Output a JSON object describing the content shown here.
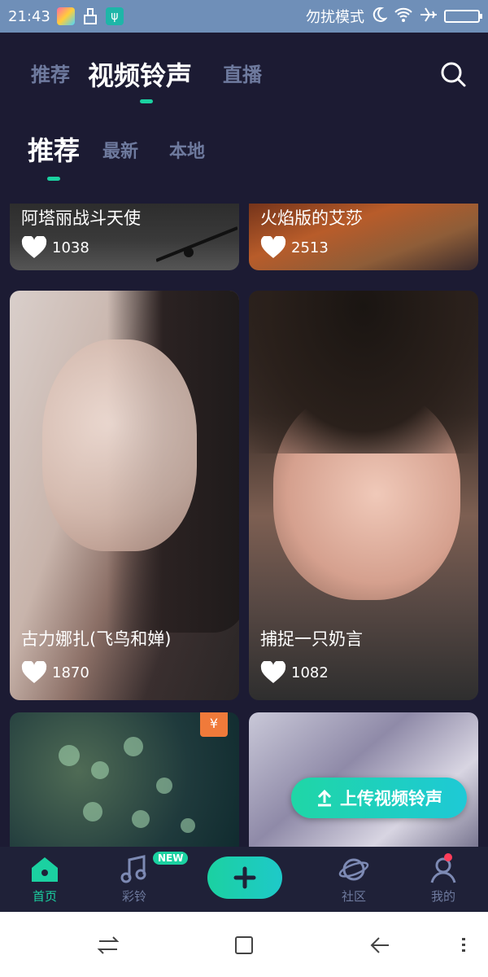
{
  "status_bar": {
    "time": "21:43",
    "dnd_label": "勿扰模式",
    "icons": [
      "photos-app-icon",
      "cleaner-icon",
      "usb-icon",
      "moon-icon",
      "wifi-icon",
      "airplane-icon",
      "battery-icon"
    ]
  },
  "top_tabs": {
    "items": [
      "推荐",
      "视频铃声",
      "直播"
    ],
    "active": "视频铃声"
  },
  "sub_tabs": {
    "items": [
      "推荐",
      "最新",
      "本地"
    ],
    "active": "推荐"
  },
  "cards": [
    {
      "title": "阿塔丽战斗天使",
      "likes": "1038"
    },
    {
      "title": "火焰版的艾莎",
      "likes": "2513"
    },
    {
      "title": "古力娜扎(飞鸟和婵)",
      "likes": "1870"
    },
    {
      "title": "捕捉一只奶言",
      "likes": "1082"
    },
    {
      "badge": "¥"
    },
    {}
  ],
  "upload_button": {
    "label": "上传视频铃声"
  },
  "bottom_nav": {
    "items": [
      {
        "label": "首页",
        "icon": "home-icon",
        "active": true
      },
      {
        "label": "彩铃",
        "icon": "music-note-icon",
        "badge": "NEW"
      },
      {
        "label": "",
        "icon": "plus-icon"
      },
      {
        "label": "社区",
        "icon": "planet-icon"
      },
      {
        "label": "我的",
        "icon": "profile-icon"
      }
    ]
  },
  "colors": {
    "background": "#1c1b33",
    "accent": "#1bd1a1",
    "inactive_text": "#6e7a9e",
    "status_bar": "#6f8fb8"
  }
}
